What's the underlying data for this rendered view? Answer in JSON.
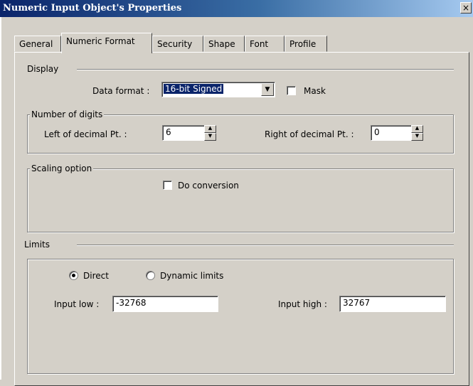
{
  "window": {
    "title": "Numeric Input Object's Properties",
    "close": "×"
  },
  "tabs": [
    {
      "label": "General"
    },
    {
      "label": "Numeric Format"
    },
    {
      "label": "Security"
    },
    {
      "label": "Shape"
    },
    {
      "label": "Font"
    },
    {
      "label": "Profile"
    }
  ],
  "display": {
    "section_label": "Display",
    "data_format_label": "Data format :",
    "data_format_value": "16-bit Signed",
    "mask_label": "Mask"
  },
  "digits": {
    "legend": "Number of digits",
    "left_label": "Left of decimal Pt. :",
    "left_value": "6",
    "right_label": "Right of decimal Pt. :",
    "right_value": "0"
  },
  "scaling": {
    "legend": "Scaling option",
    "conversion_label": "Do conversion"
  },
  "limits": {
    "section_label": "Limits",
    "direct_label": "Direct",
    "dynamic_label": "Dynamic limits",
    "low_label": "Input low :",
    "low_value": "-32768",
    "high_label": "Input high :",
    "high_value": "32767"
  }
}
